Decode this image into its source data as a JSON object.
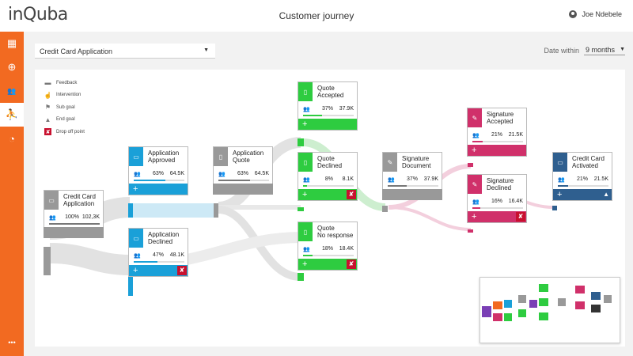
{
  "app": {
    "logo_text": "inQuba",
    "page_title": "Customer journey",
    "user_name": "Joe Ndebele"
  },
  "sidebar": {
    "items": [
      {
        "icon": "dashboard-icon",
        "glyph": "▦"
      },
      {
        "icon": "add-icon",
        "glyph": "⊕"
      },
      {
        "icon": "users-icon",
        "glyph": "👥"
      },
      {
        "icon": "journey-icon",
        "glyph": "⛹"
      },
      {
        "icon": "analytics-icon",
        "glyph": "◔"
      }
    ],
    "more_glyph": "•••"
  },
  "filters": {
    "journey_select": "Credit Card Application",
    "date_label": "Date within",
    "date_value": "9 months"
  },
  "legend": [
    {
      "icon": "feedback-icon",
      "glyph": "▬",
      "label": "Feedback"
    },
    {
      "icon": "intervention-icon",
      "glyph": "☝",
      "label": "Intervention"
    },
    {
      "icon": "sub-goal-icon",
      "glyph": "⚑",
      "label": "Sub goal"
    },
    {
      "icon": "end-goal-icon",
      "glyph": "▲",
      "label": "End goal"
    },
    {
      "icon": "drop-off-icon",
      "glyph": "✘",
      "label": "Drop off point"
    }
  ],
  "colors": {
    "orange": "#f26a21",
    "blue": "#1aa0d8",
    "gray": "#999999",
    "green": "#2ecc40",
    "pink": "#d0306a",
    "navy": "#2f5f8f",
    "drop": "#c8102e"
  },
  "cards": [
    {
      "id": "credit-card-application",
      "title": "Credit Card\nApplication",
      "pct": "100%",
      "count": "102,3K",
      "fill": 1.0,
      "color": "#999999",
      "icon_glyph": "▭",
      "footer": "none"
    },
    {
      "id": "application-approved",
      "title": "Application\nApproved",
      "pct": "63%",
      "count": "64.5K",
      "fill": 0.63,
      "color": "#1aa0d8",
      "icon_glyph": "▭",
      "footer": "plus"
    },
    {
      "id": "application-declined",
      "title": "Application\nDeclined",
      "pct": "47%",
      "count": "48.1K",
      "fill": 0.47,
      "color": "#1aa0d8",
      "icon_glyph": "▭",
      "footer": "plus-drop"
    },
    {
      "id": "application-quote",
      "title": "Application\nQuote",
      "pct": "63%",
      "count": "64.5K",
      "fill": 0.63,
      "color": "#999999",
      "icon_glyph": "▯",
      "footer": "none"
    },
    {
      "id": "quote-accepted",
      "title": "Quote\nAccepted",
      "pct": "37%",
      "count": "37.9K",
      "fill": 0.37,
      "color": "#2ecc40",
      "icon_glyph": "▯",
      "footer": "plus"
    },
    {
      "id": "quote-declined",
      "title": "Quote\nDeclined",
      "pct": "8%",
      "count": "8.1K",
      "fill": 0.08,
      "color": "#2ecc40",
      "icon_glyph": "▯",
      "footer": "plus-drop"
    },
    {
      "id": "quote-no-response",
      "title": "Quote\nNo response",
      "pct": "18%",
      "count": "18.4K",
      "fill": 0.18,
      "color": "#2ecc40",
      "icon_glyph": "▯",
      "footer": "plus-drop"
    },
    {
      "id": "signature-document",
      "title": "Signature\nDocument",
      "pct": "37%",
      "count": "37.9K",
      "fill": 0.37,
      "color": "#999999",
      "icon_glyph": "✎",
      "footer": "none"
    },
    {
      "id": "signature-accepted",
      "title": "Signature\nAccepted",
      "pct": "21%",
      "count": "21.5K",
      "fill": 0.21,
      "color": "#d0306a",
      "icon_glyph": "✎",
      "footer": "plus"
    },
    {
      "id": "signature-declined",
      "title": "Signature\nDeclined",
      "pct": "16%",
      "count": "16.4K",
      "fill": 0.16,
      "color": "#d0306a",
      "icon_glyph": "✎",
      "footer": "plus-drop"
    },
    {
      "id": "credit-card-activated",
      "title": "Credit Card\nActivated",
      "pct": "21%",
      "count": "21.5K",
      "fill": 0.21,
      "color": "#2f5f8f",
      "icon_glyph": "▭",
      "footer": "plus-goal"
    }
  ]
}
